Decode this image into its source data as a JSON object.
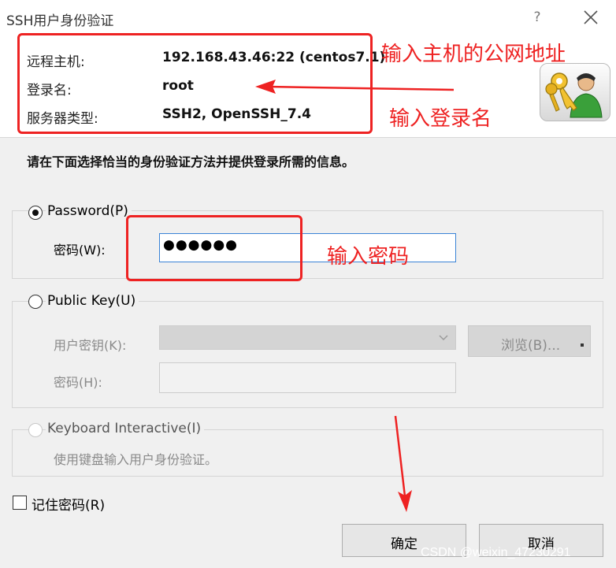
{
  "window": {
    "title": "SSH用户身份验证",
    "help_label": "?",
    "help_icon": "help-icon",
    "close_icon": "close-icon"
  },
  "server_info": {
    "host_label": "远程主机:",
    "host_value": "192.168.43.46:22 (centos7.1)",
    "login_label": "登录名:",
    "login_value": "root",
    "server_type_label": "服务器类型:",
    "server_type_value": "SSH2, OpenSSH_7.4",
    "logo_icon": "key-user-icon"
  },
  "annotations": {
    "public_ip": "输入主机的公网地址",
    "login_name": "输入登录名",
    "password": "输入密码",
    "color": "#ee2222"
  },
  "instruction": "请在下面选择恰当的身份验证方法并提供登录所需的信息。",
  "password_method": {
    "label": "Password(P)",
    "selected": true,
    "password_label": "密码(W):",
    "password_masked": "●●●●●●"
  },
  "public_key_method": {
    "label": "Public Key(U)",
    "selected": false,
    "user_key_label": "用户密钥(K):",
    "user_key_value": "",
    "browse_label": "浏览(B)...",
    "passphrase_label": "密码(H):",
    "passphrase_value": ""
  },
  "keyboard_method": {
    "label": "Keyboard Interactive(I)",
    "selected": false,
    "description": "使用键盘输入用户身份验证。"
  },
  "remember_password": {
    "label": "记住密码(R)",
    "checked": false
  },
  "buttons": {
    "ok": "确定",
    "cancel": "取消"
  },
  "watermark": "CSDN @weixin_47230291"
}
